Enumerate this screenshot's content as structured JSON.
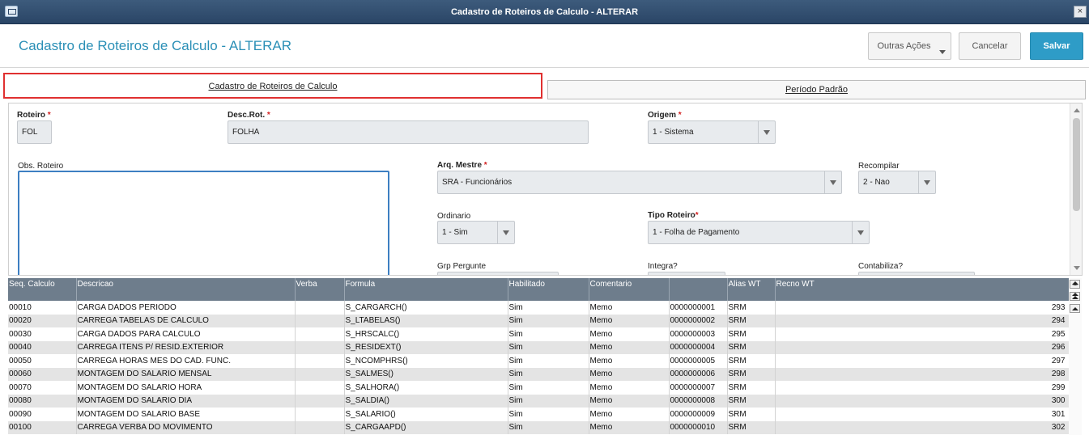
{
  "window": {
    "title": "Cadastro de Roteiros de Calculo - ALTERAR",
    "close_label": "×"
  },
  "header": {
    "page_title": "Cadastro de Roteiros de Calculo - ALTERAR",
    "outras_label": "Outras Ações",
    "cancelar_label": "Cancelar",
    "salvar_label": "Salvar",
    "accent_color": "#2e9cc7"
  },
  "tabs": [
    {
      "label": "Cadastro de Roteiros de Calculo",
      "active": true
    },
    {
      "label": "Período Padrão",
      "active": false
    }
  ],
  "form": {
    "roteiro": {
      "label": "Roteiro",
      "value": "FOL"
    },
    "desc_rot": {
      "label": "Desc.Rot.",
      "value": "FOLHA"
    },
    "origem": {
      "label": "Origem",
      "value": "1 - Sistema"
    },
    "obs_roteiro": {
      "label": "Obs. Roteiro",
      "value": ""
    },
    "arq_mestre": {
      "label": "Arq. Mestre",
      "value": "SRA - Funcionários"
    },
    "recompilar": {
      "label": "Recompilar",
      "value": "2 - Nao"
    },
    "ordinario": {
      "label": "Ordinario",
      "value": "1 - Sim"
    },
    "tipo_roteiro": {
      "label": "Tipo Roteiro",
      "value": "1 - Folha de Pagamento"
    },
    "grp_pergunte": {
      "label": "Grp Pergunte"
    },
    "integra": {
      "label": "Integra?"
    },
    "contabiliza": {
      "label": "Contabiliza?"
    },
    "required_mark": "*"
  },
  "grid": {
    "columns": [
      "Seq. Calculo",
      "Descricao",
      "Verba",
      "Formula",
      "Habilitado",
      "Comentario",
      "",
      "Alias WT",
      "Recno WT"
    ],
    "rows": [
      [
        "00010",
        "CARGA DADOS PERIODO",
        "",
        "S_CARGARCH()",
        "Sim",
        "Memo",
        "0000000001",
        "SRM",
        "293"
      ],
      [
        "00020",
        "CARREGA TABELAS DE CALCULO",
        "",
        "S_LTABELAS()",
        "Sim",
        "Memo",
        "0000000002",
        "SRM",
        "294"
      ],
      [
        "00030",
        "CARGA DADOS PARA CALCULO",
        "",
        "S_HRSCALC()",
        "Sim",
        "Memo",
        "0000000003",
        "SRM",
        "295"
      ],
      [
        "00040",
        "CARREGA ITENS P/ RESID.EXTERIOR",
        "",
        "S_RESIDEXT()",
        "Sim",
        "Memo",
        "0000000004",
        "SRM",
        "296"
      ],
      [
        "00050",
        "CARREGA HORAS MES DO CAD. FUNC.",
        "",
        "S_NCOMPHRS()",
        "Sim",
        "Memo",
        "0000000005",
        "SRM",
        "297"
      ],
      [
        "00060",
        "MONTAGEM DO SALARIO MENSAL",
        "",
        "S_SALMES()",
        "Sim",
        "Memo",
        "0000000006",
        "SRM",
        "298"
      ],
      [
        "00070",
        "MONTAGEM DO SALARIO HORA",
        "",
        "S_SALHORA()",
        "Sim",
        "Memo",
        "0000000007",
        "SRM",
        "299"
      ],
      [
        "00080",
        "MONTAGEM DO SALARIO DIA",
        "",
        "S_SALDIA()",
        "Sim",
        "Memo",
        "0000000008",
        "SRM",
        "300"
      ],
      [
        "00090",
        "MONTAGEM DO SALARIO BASE",
        "",
        "S_SALARIO()",
        "Sim",
        "Memo",
        "0000000009",
        "SRM",
        "301"
      ],
      [
        "00100",
        "CARREGA VERBA DO MOVIMENTO",
        "",
        "S_CARGAAPD()",
        "Sim",
        "Memo",
        "0000000010",
        "SRM",
        "302"
      ]
    ]
  }
}
